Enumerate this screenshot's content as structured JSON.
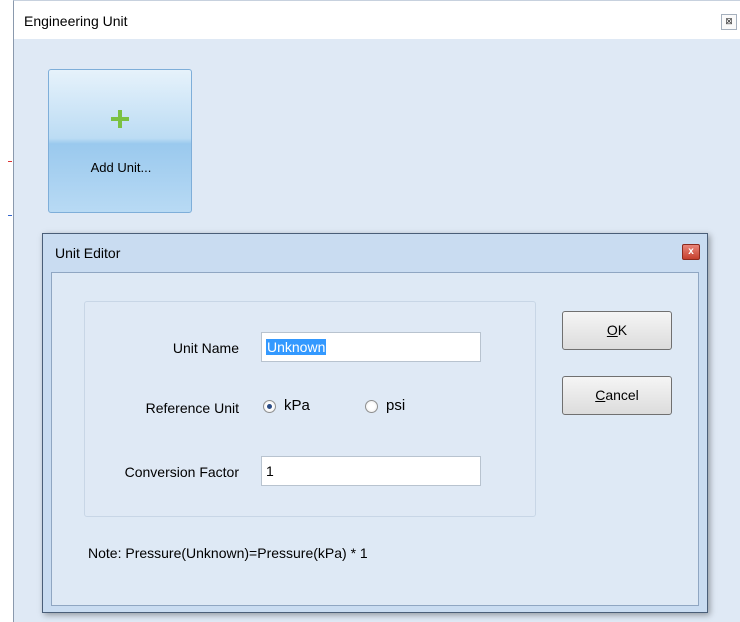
{
  "outer_window": {
    "title": "Engineering Unit",
    "close_glyph": "⊠"
  },
  "add_tile": {
    "label": "Add Unit..."
  },
  "dialog": {
    "title": "Unit Editor",
    "close_glyph": "x",
    "unit_name_label": "Unit Name",
    "unit_name_value": "Unknown",
    "reference_unit_label": "Reference Unit",
    "reference_options": [
      {
        "label": "kPa",
        "checked": true
      },
      {
        "label": "psi",
        "checked": false
      }
    ],
    "conversion_factor_label": "Conversion Factor",
    "conversion_factor_value": "1",
    "ok_mnemonic": "O",
    "ok_rest": "K",
    "cancel_mnemonic": "C",
    "cancel_rest": "ancel",
    "note": "Note: Pressure(Unknown)=Pressure(kPa) * 1"
  },
  "colors": {
    "window_bg": "#dfe9f5",
    "dialog_frame": "#c9dcf1",
    "plus_icon": "#7bc142",
    "selection": "#3399ff"
  }
}
